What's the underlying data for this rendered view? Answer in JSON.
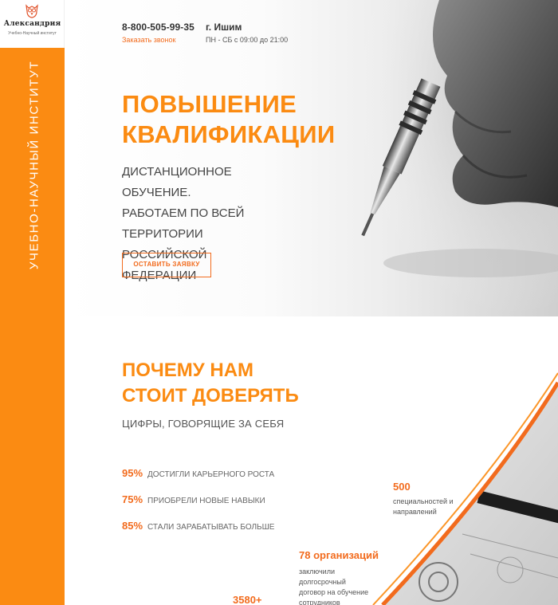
{
  "brand": {
    "name": "Александрия",
    "tagline": "Учебно-Научный институт",
    "vertical_label": "УЧЕБНО-НАУЧНЫЙ ИНСТИТУТ",
    "accent_color": "#fb8b12",
    "accent_dark": "#f26b1d"
  },
  "header": {
    "phone": "8-800-505-99-35",
    "callback_label": "Заказать звонок",
    "city": "г. Ишим",
    "hours": "ПН - СБ с 09:00 до 21:00"
  },
  "hero": {
    "title_line1": "ПОВЫШЕНИЕ",
    "title_line2": "КВАЛИФИКАЦИИ",
    "subtitle_line1": "ДИСТАНЦИОННОЕ ОБУЧЕНИЕ.",
    "subtitle_line2": "РАБОТАЕМ ПО ВСЕЙ",
    "subtitle_line3": "ТЕРРИТОРИИ РОССИЙСКОЙ",
    "subtitle_line4": "ФЕДЕРАЦИИ",
    "cta_label": "ОСТАВИТЬ ЗАЯВКУ",
    "image_icon": "pen-in-hand-icon"
  },
  "trust": {
    "title_line1": "ПОЧЕМУ НАМ",
    "title_line2": "СТОИТ ДОВЕРЯТЬ",
    "subtitle": "ЦИФРЫ, ГОВОРЯЩИЕ ЗА СЕБЯ",
    "stats": [
      {
        "value": "95%",
        "label": "ДОСТИГЛИ КАРЬЕРНОГО РОСТА"
      },
      {
        "value": "75%",
        "label": "ПРИОБРЕЛИ НОВЫЕ НАВЫКИ"
      },
      {
        "value": "85%",
        "label": "СТАЛИ ЗАРАБАТЫВАТЬ БОЛЬШЕ"
      }
    ],
    "specialties": {
      "value": "500",
      "line1": "специальностей и",
      "line2": "направлений"
    },
    "organizations": {
      "value": "78 организаций",
      "line1": "заключили долгосрочный",
      "line2": "договор на обучение",
      "line3": "сотрудников"
    },
    "students": {
      "value": "3580+"
    }
  }
}
